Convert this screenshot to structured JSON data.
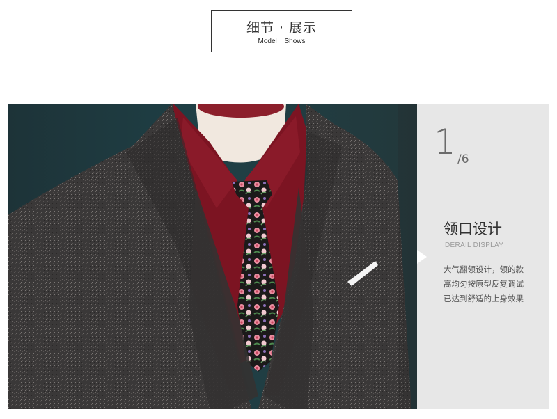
{
  "header": {
    "title_cn": "细节 · 展示",
    "title_en": "Model Shows"
  },
  "photo": {
    "subject": "suit-collar-photo",
    "colors": {
      "background": "#1f3a40",
      "suit": "#3a3838",
      "shirt": "#7c1422",
      "mannequin": "#f1e8df",
      "tie_base": "#1a1a1a",
      "pocket_square": "#f5f5f5"
    }
  },
  "panel": {
    "page_current": "1",
    "page_total": "/6",
    "title": "领口设计",
    "subtitle": "DERAIL DISPLAY",
    "description": [
      "大气翻领设计，领的款",
      "高均匀按原型反复调试",
      "已达到舒适的上身效果"
    ],
    "background": "#e7e7e7"
  }
}
